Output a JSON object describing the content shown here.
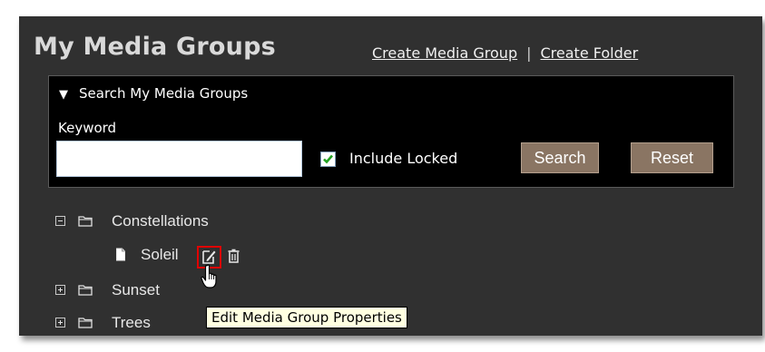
{
  "header": {
    "title": "My Media Groups",
    "links": {
      "create_group": "Create Media Group",
      "separator": "|",
      "create_folder": "Create Folder"
    }
  },
  "search": {
    "toggle_label": "Search My Media Groups",
    "keyword_label": "Keyword",
    "keyword_value": "",
    "include_locked_label": "Include Locked",
    "include_locked_checked": true,
    "search_button": "Search",
    "reset_button": "Reset"
  },
  "tree": {
    "folders": [
      {
        "label": "Constellations",
        "expanded": true,
        "children": [
          {
            "label": "Soleil"
          }
        ]
      },
      {
        "label": "Sunset",
        "expanded": false
      },
      {
        "label": "Trees",
        "expanded": false
      }
    ]
  },
  "tooltip": {
    "text": "Edit Media Group Properties"
  },
  "icons": {
    "folder": "folder-icon",
    "document": "document-icon",
    "edit": "edit-icon",
    "delete": "trash-icon",
    "cursor": "hand-pointer-icon"
  },
  "colors": {
    "panel_bg": "#303030",
    "search_bg": "#000000",
    "button_bg": "#8a7563",
    "highlight": "#e00000",
    "tooltip_bg": "#ffffe1"
  }
}
